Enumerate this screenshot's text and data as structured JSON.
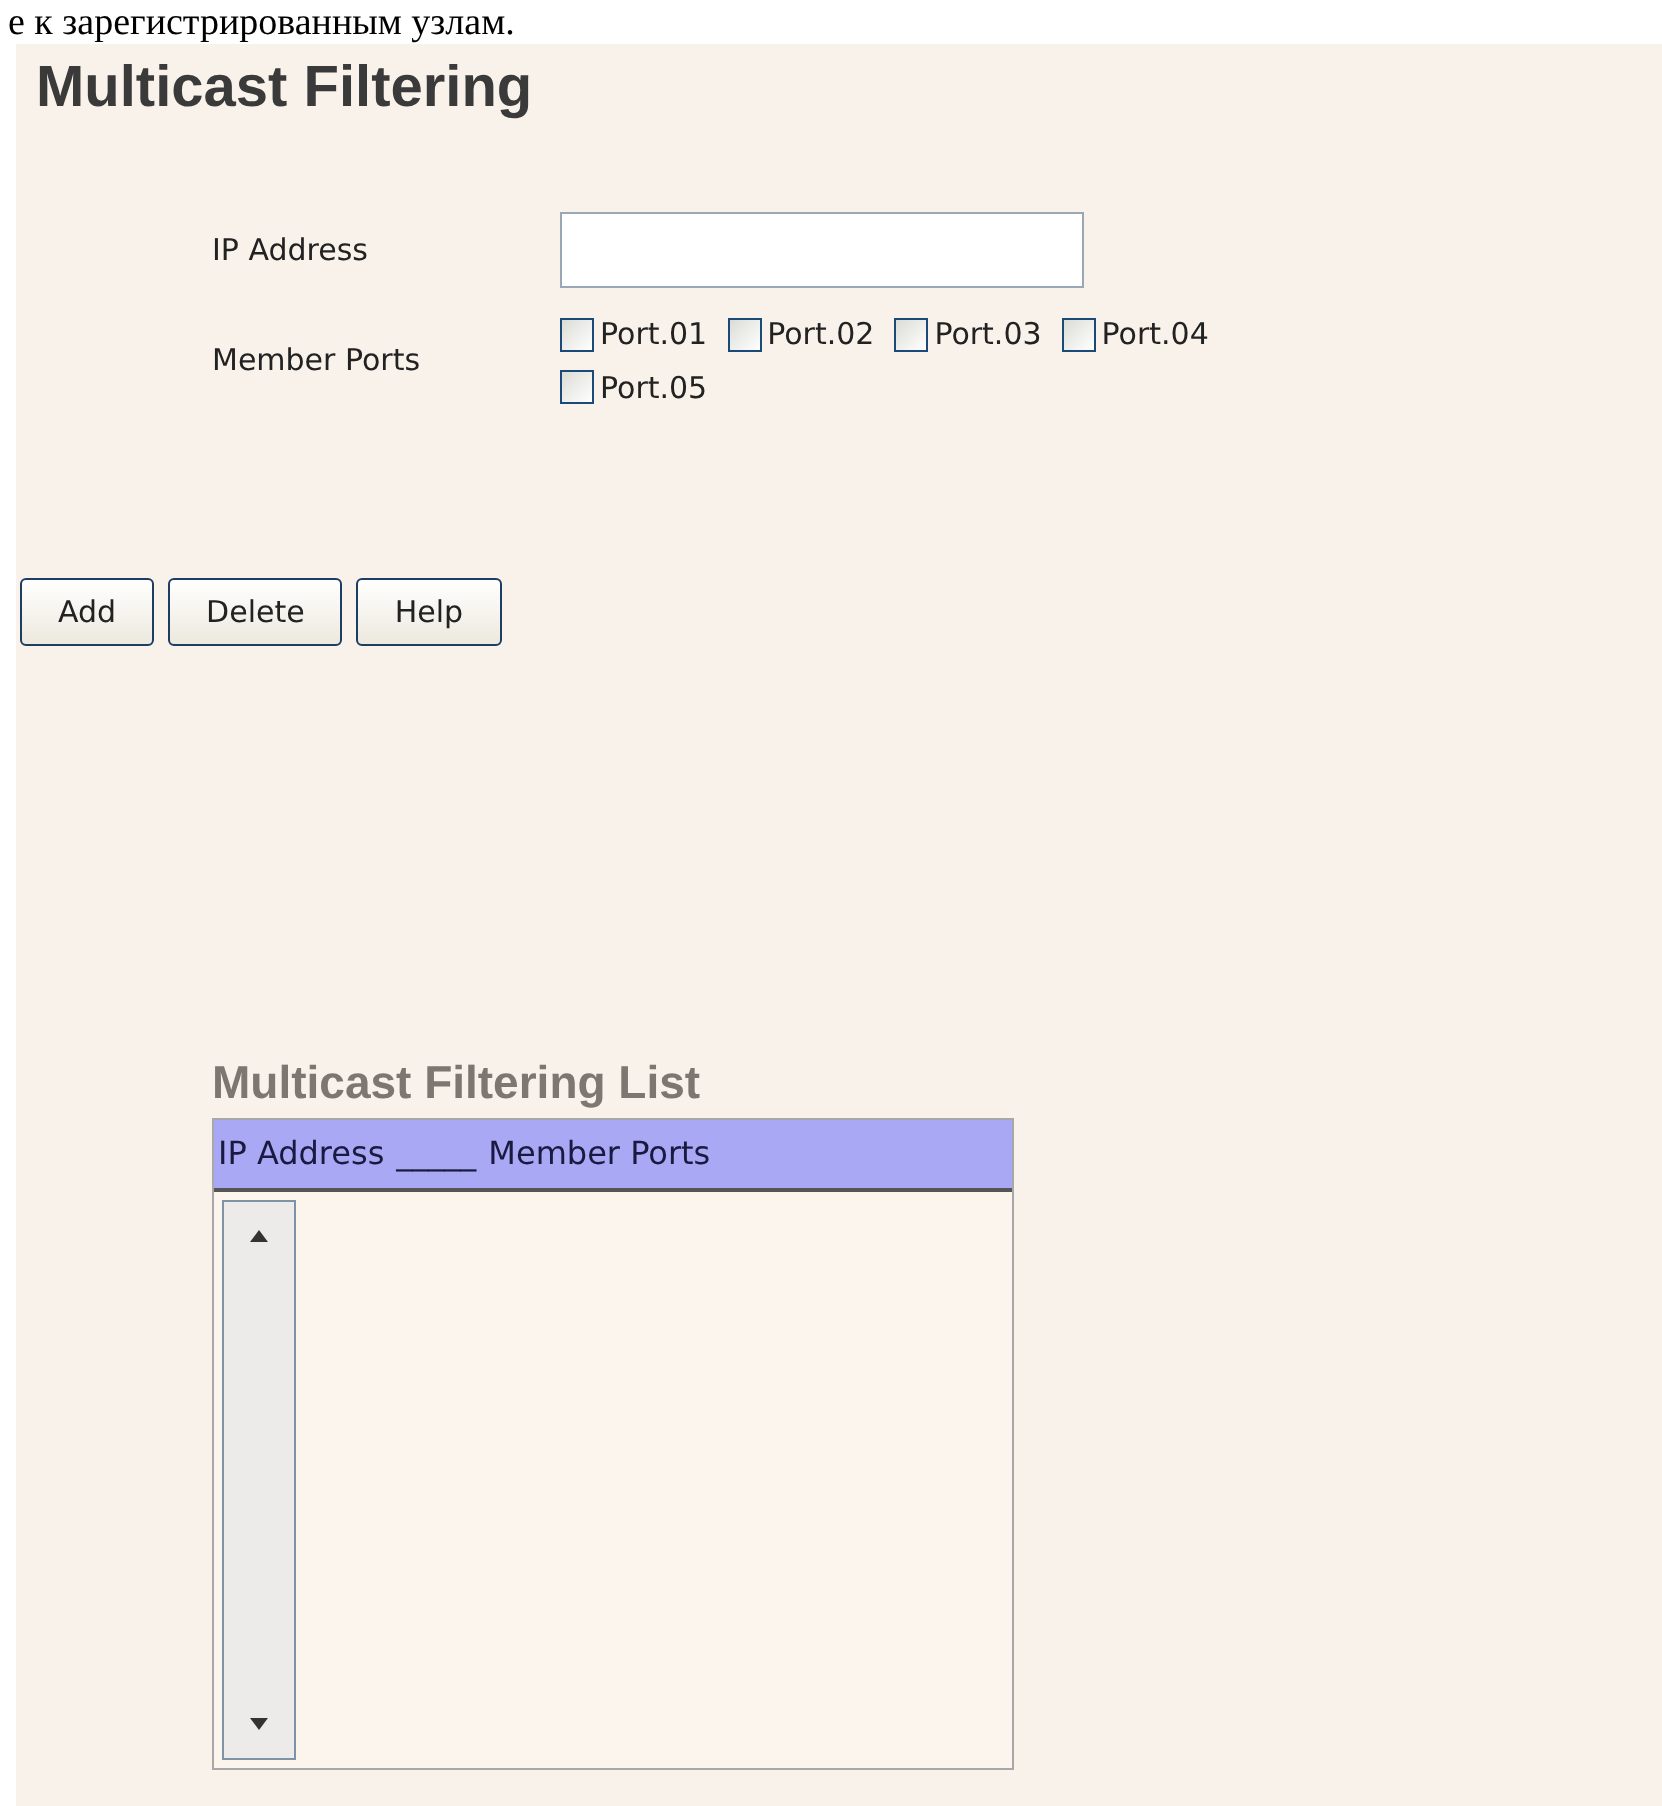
{
  "caption": "е к зарегистрированным узлам.",
  "title": "Multicast Filtering",
  "form": {
    "ip_label": "IP Address",
    "ports_label": "Member Ports",
    "ports": [
      {
        "label": "Port.01",
        "checked": false
      },
      {
        "label": "Port.02",
        "checked": false
      },
      {
        "label": "Port.03",
        "checked": false
      },
      {
        "label": "Port.04",
        "checked": false
      },
      {
        "label": "Port.05",
        "checked": false
      }
    ]
  },
  "buttons": [
    "Add",
    "Delete",
    "Help"
  ],
  "list": {
    "title": "Multicast Filtering List",
    "header": [
      "IP Address",
      "_____",
      "Member Ports"
    ]
  }
}
